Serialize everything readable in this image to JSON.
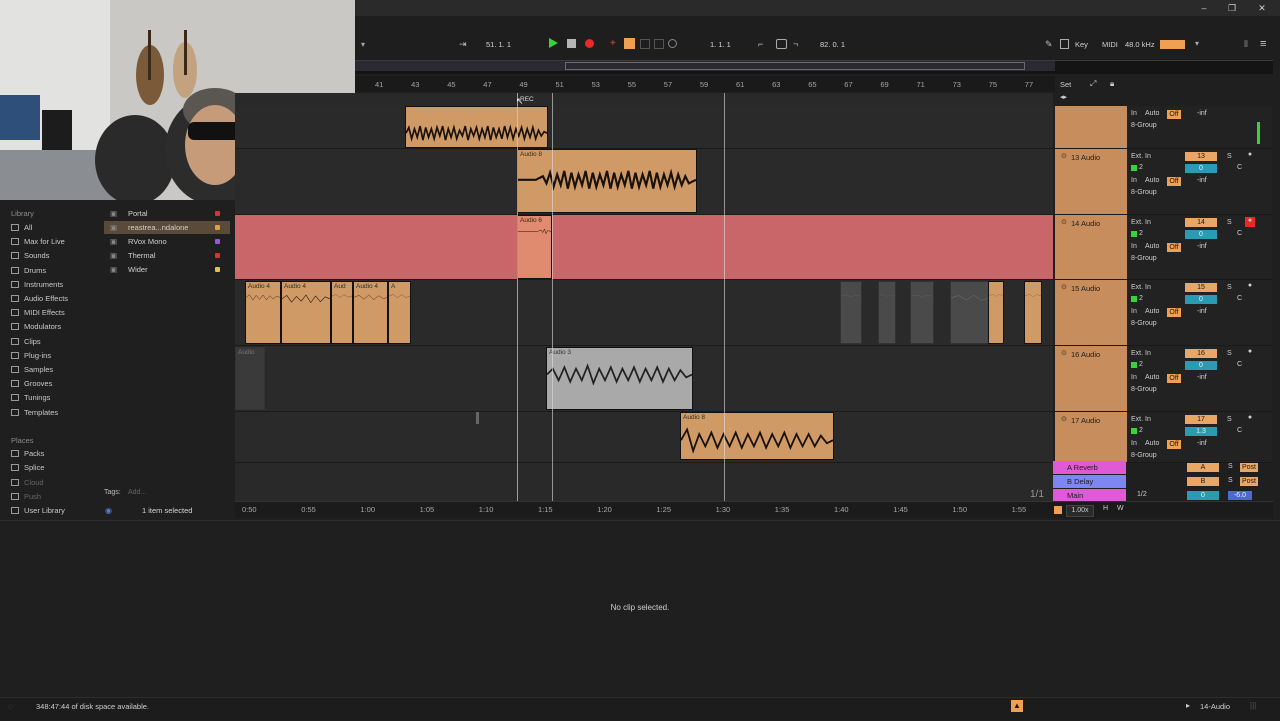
{
  "transport": {
    "position": "51.  1.  1",
    "loop_start": "1.  1.  1",
    "tempo_display": "82.  0.  1",
    "key_label": "Key",
    "midi_label": "MIDI",
    "sample_rate": "48.0 kHz"
  },
  "ruler": {
    "bars": [
      "41",
      "43",
      "45",
      "47",
      "49",
      "51",
      "53",
      "55",
      "57",
      "59",
      "61",
      "63",
      "65",
      "67",
      "69",
      "71",
      "73",
      "75",
      "77"
    ],
    "set_label": "Set",
    "rec_marker": "REC"
  },
  "time_ruler": {
    "ticks": [
      "0:50",
      "0:55",
      "1:00",
      "1:05",
      "1:10",
      "1:15",
      "1:20",
      "1:25",
      "1:30",
      "1:35",
      "1:40",
      "1:45",
      "1:50",
      "1:55"
    ],
    "zoom": "1.00x",
    "page": "1/1",
    "h_label": "H",
    "w_label": "W"
  },
  "browser": {
    "library_heading": "Library",
    "library_items": [
      "All",
      "Max for Live",
      "Sounds",
      "Drums",
      "Instruments",
      "Audio Effects",
      "MIDI Effects",
      "Modulators",
      "Clips",
      "Plug-ins",
      "Samples",
      "Grooves",
      "Tunings",
      "Templates"
    ],
    "places_heading": "Places",
    "places_items": [
      "Packs",
      "Splice",
      "Cloud",
      "Push",
      "User Library"
    ],
    "folders": [
      {
        "name": "Portal",
        "dot": "#e0302a"
      },
      {
        "name": "reastrea...ndalone",
        "dot": "#e3a03d"
      },
      {
        "name": "RVox Mono",
        "dot": "#9955ee"
      },
      {
        "name": "Thermal",
        "dot": "#e0302a"
      },
      {
        "name": "Wider",
        "dot": "#e3c23d"
      }
    ],
    "tags_label": "Tags:",
    "tags_placeholder": "Add...",
    "selection_status": "1 item selected"
  },
  "clips": {
    "audio8": "Audio 8",
    "audio6": "Audio 6",
    "audio4_a": "Audio 4",
    "audio4_b": "Audio 4",
    "audio4_c": "Aud",
    "audio4_d": "Audio 4",
    "audio4_e": "A",
    "audio_left": "Audio",
    "audio3": "Audio 3",
    "audio8b": "Audio 8"
  },
  "tracks": [
    {
      "name": "",
      "number": "",
      "input": "In",
      "auto": "Auto",
      "off": "Off",
      "group": "8-Group",
      "vol": "-inf"
    },
    {
      "name": "13 Audio",
      "number": "13",
      "input": "Ext. In",
      "channel": "2",
      "pan": "C",
      "monitor_in": "In",
      "auto": "Auto",
      "off": "Off",
      "group": "8-Group",
      "vol": "-inf",
      "send": "0"
    },
    {
      "name": "14 Audio",
      "number": "14",
      "input": "Ext. In",
      "channel": "2",
      "pan": "C",
      "monitor_in": "In",
      "auto": "Auto",
      "off": "Off",
      "group": "8-Group",
      "vol": "-inf",
      "send": "0"
    },
    {
      "name": "15 Audio",
      "number": "15",
      "input": "Ext. In",
      "channel": "2",
      "pan": "C",
      "monitor_in": "In",
      "auto": "Auto",
      "off": "Off",
      "group": "8-Group",
      "vol": "-inf",
      "send": "0"
    },
    {
      "name": "16 Audio",
      "number": "16",
      "input": "Ext. In",
      "channel": "2",
      "pan": "C",
      "monitor_in": "In",
      "auto": "Auto",
      "off": "Off",
      "group": "8-Group",
      "vol": "-inf",
      "send": "0"
    },
    {
      "name": "17 Audio",
      "number": "17",
      "input": "Ext. In",
      "channel": "2",
      "pan": "C",
      "monitor_in": "In",
      "auto": "Auto",
      "off": "Off",
      "group": "8-Group",
      "vol": "-inf",
      "send": "1.3"
    }
  ],
  "return_tracks": [
    {
      "name": "A Reverb",
      "letter": "A",
      "post": "Post",
      "color": "#e05ad6"
    },
    {
      "name": "B Delay",
      "letter": "B",
      "post": "Post",
      "color": "#7e86f2"
    }
  ],
  "main_track": {
    "name": "Main",
    "input": "1/2",
    "send": "0",
    "vol": "-6.0",
    "color": "#e05ad6"
  },
  "detail": {
    "message": "No clip selected."
  },
  "status": {
    "disk": "348:47:44 of disk space available.",
    "selected_track": "14-Audio"
  },
  "colors": {
    "accent": "#f0a050",
    "track_orange": "#c78d5c",
    "armed_red": "#c9666a",
    "play_green": "#3ad23a",
    "record_red": "#e62a2a"
  }
}
